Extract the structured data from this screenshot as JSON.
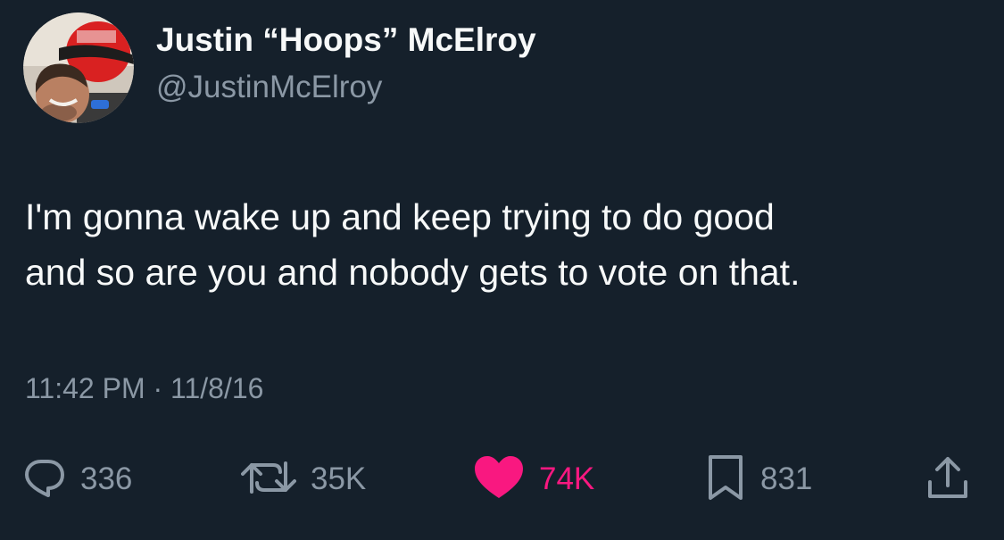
{
  "author": {
    "display_name": "Justin “Hoops” McElroy",
    "handle": "@JustinMcElroy",
    "avatar_icon": "profile-photo-avatar"
  },
  "tweet": {
    "text_lines": [
      "I'm gonna wake up and keep trying to do good",
      "and so are you and nobody gets to vote on that."
    ],
    "time": "11:42 PM",
    "separator": "·",
    "date": "11/8/16"
  },
  "actions": {
    "reply": {
      "icon": "reply-icon",
      "count": "336"
    },
    "retweet": {
      "icon": "retweet-icon",
      "count": "35K"
    },
    "like": {
      "icon": "heart-icon",
      "count": "74K",
      "color": "#f91880",
      "liked": true
    },
    "bookmark": {
      "icon": "bookmark-icon",
      "count": "831"
    },
    "share": {
      "icon": "share-icon"
    }
  },
  "colors": {
    "background": "#15202b",
    "primary_text": "#f7f9f9",
    "secondary_text": "#8b98a5",
    "like_accent": "#f91880"
  }
}
